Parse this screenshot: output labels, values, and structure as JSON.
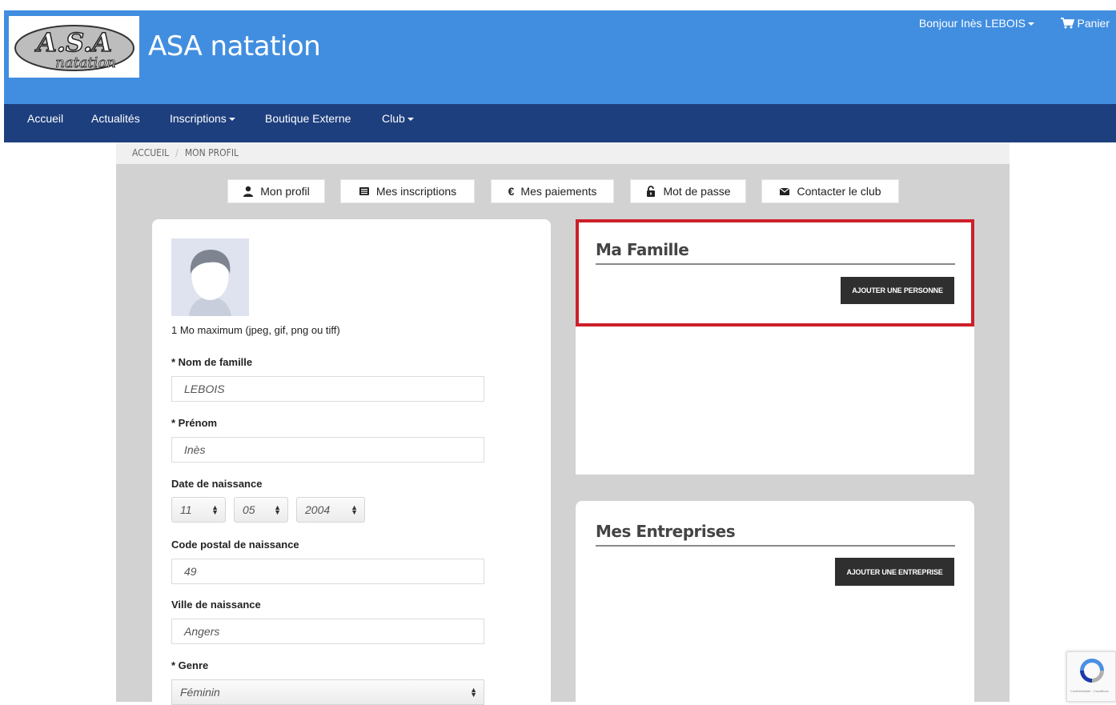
{
  "header": {
    "site_title": "ASA natation",
    "logo_text": "A.S.A natation",
    "greeting": "Bonjour Inès LEBOIS",
    "cart_label": "Panier"
  },
  "nav": {
    "items": [
      "Accueil",
      "Actualités",
      "Inscriptions",
      "Boutique Externe",
      "Club"
    ]
  },
  "breadcrumb": {
    "home": "ACCUEIL",
    "separator": "/",
    "current": "MON PROFIL"
  },
  "tabs": {
    "profile": "Mon profil",
    "registrations": "Mes inscriptions",
    "payments": "Mes paiements",
    "password": "Mot de passe",
    "contact": "Contacter le club"
  },
  "profile": {
    "photo_hint": "1 Mo maximum (jpeg, gif, png ou tiff)",
    "last_name_label": "* Nom de famille",
    "last_name_value": "LEBOIS",
    "first_name_label": "* Prénom",
    "first_name_value": "Inès",
    "birth_date_label": "Date de naissance",
    "birth_day": "11",
    "birth_month": "05",
    "birth_year": "2004",
    "birth_postal_label": "Code postal de naissance",
    "birth_postal_value": "49",
    "birth_city_label": "Ville de naissance",
    "birth_city_value": "Angers",
    "gender_label": "* Genre",
    "gender_value": "Féminin"
  },
  "family": {
    "title": "Ma Famille",
    "add_button": "AJOUTER UNE PERSONNE"
  },
  "companies": {
    "title": "Mes Entreprises",
    "add_button": "AJOUTER UNE ENTREPRISE"
  },
  "recaptcha": {
    "footer": "Confidentialité - Conditions"
  },
  "colors": {
    "header_blue": "#418ee0",
    "nav_navy": "#1d3f7e",
    "highlight_red": "#cd1f2a",
    "button_dark": "#2f2f2f"
  }
}
